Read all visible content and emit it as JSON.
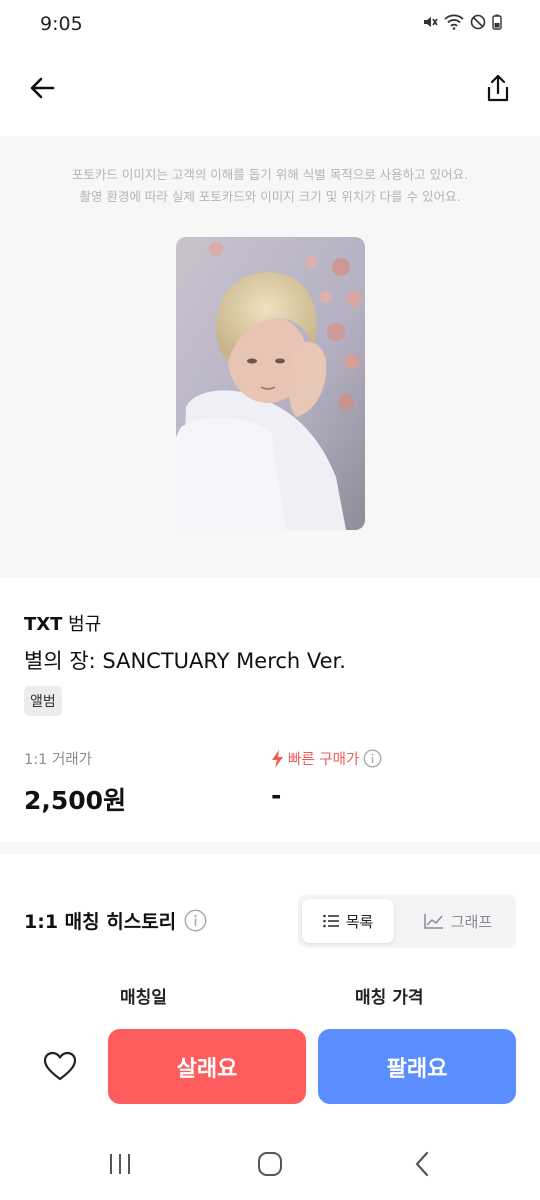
{
  "status_bar": {
    "time": "9:05",
    "icons": [
      "mute-icon",
      "wifi-icon",
      "do-not-disturb-icon",
      "battery-icon"
    ]
  },
  "top_bar": {
    "back_icon": "arrow-left-icon",
    "share_icon": "share-icon"
  },
  "image_area": {
    "notice_line1": "포토카드 이미지는 고객의 이해를 돕기 위해 식별 목적으로 사용하고 있어요.",
    "notice_line2": "촬영 환경에 따라 실제 포토카드와 이미지 크기 및 위치가 다를 수 있어요."
  },
  "product": {
    "group": "TXT",
    "member": "범규",
    "title": "별의 장: SANCTUARY Merch Ver.",
    "tag": "앨범"
  },
  "price": {
    "trade_label": "1:1 거래가",
    "trade_value": "2,500원",
    "fast_label": "빠른 구매가",
    "fast_value": "-"
  },
  "history": {
    "title": "1:1 매칭 히스토리",
    "tab_list": "목록",
    "tab_graph": "그래프",
    "selected_tab": "목록",
    "col_date": "매칭일",
    "col_price": "매칭 가격"
  },
  "actions": {
    "buy_label": "살래요",
    "sell_label": "팔래요"
  },
  "colors": {
    "buy": "#ff5d5d",
    "sell": "#5b8dff",
    "fast_accent": "#f15a5a"
  }
}
